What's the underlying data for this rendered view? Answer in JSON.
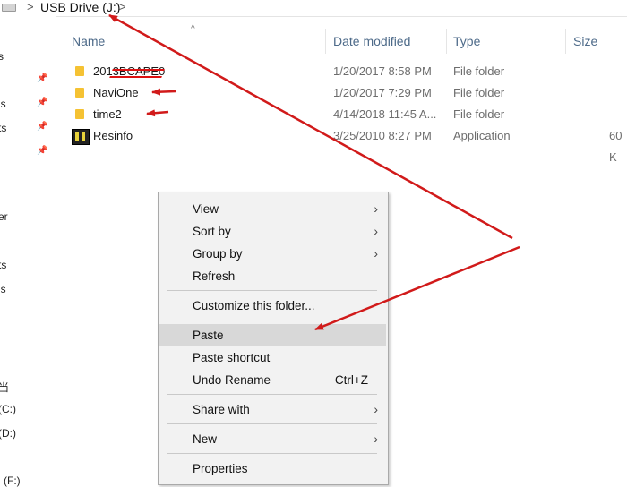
{
  "address_bar": {
    "separator": ">",
    "crumb": "USB Drive (J:)"
  },
  "nav_pane": {
    "items": [
      {
        "text": "s"
      },
      {
        "text": "ls"
      },
      {
        "text": "ts"
      },
      {
        "text": "er"
      },
      {
        "text": "ts"
      },
      {
        "text": "ls"
      },
      {
        "text": "当"
      },
      {
        "text": "(C:)"
      },
      {
        "text": "(D:)"
      },
      {
        "text": "l (F:)"
      }
    ]
  },
  "columns": {
    "name": "Name",
    "date": "Date modified",
    "type": "Type",
    "size": "Size"
  },
  "files": [
    {
      "name": "2013BCAPE0",
      "date": "1/20/2017 8:58 PM",
      "type": "File folder",
      "size": "",
      "icon": "folder-icon"
    },
    {
      "name": "NaviOne",
      "date": "1/20/2017 7:29 PM",
      "type": "File folder",
      "size": "",
      "icon": "folder-icon"
    },
    {
      "name": "time2",
      "date": "4/14/2018 11:45 A...",
      "type": "File folder",
      "size": "",
      "icon": "folder-icon"
    },
    {
      "name": "Resinfo",
      "date": "3/25/2010 8:27 PM",
      "type": "Application",
      "size": "60 K",
      "icon": "application-icon"
    }
  ],
  "context_menu": {
    "view": "View",
    "sort_by": "Sort by",
    "group_by": "Group by",
    "refresh": "Refresh",
    "customize": "Customize this folder...",
    "paste": "Paste",
    "paste_shortcut": "Paste shortcut",
    "undo_rename": "Undo Rename",
    "undo_shortcut": "Ctrl+Z",
    "share_with": "Share with",
    "new": "New",
    "properties": "Properties",
    "submenu_glyph": "›"
  },
  "colors": {
    "annotation_arrow": "#d11a1a",
    "menu_highlight": "#d8d8d8",
    "header_text": "#4d6a89"
  }
}
